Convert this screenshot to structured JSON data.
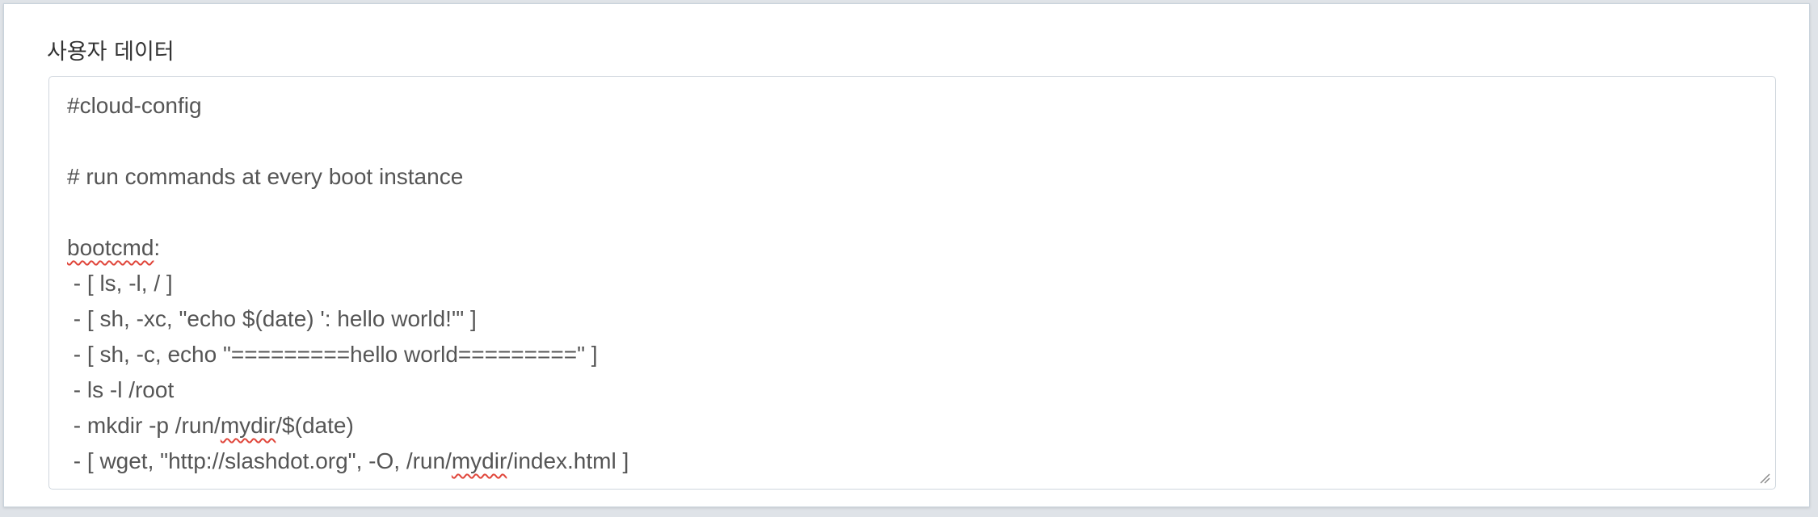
{
  "user_data": {
    "label": "사용자 데이터",
    "lines": [
      {
        "segments": [
          "#cloud-config"
        ]
      },
      {
        "segments": [
          ""
        ]
      },
      {
        "segments": [
          "# run commands at every boot instance"
        ]
      },
      {
        "segments": [
          ""
        ]
      },
      {
        "segments": [
          "bootcmd",
          ":"
        ]
      },
      {
        "segments": [
          " - [ ls, -l, / ]"
        ]
      },
      {
        "segments": [
          " - [ sh, -xc, \"echo $(date) ': hello world!'\" ]"
        ]
      },
      {
        "segments": [
          " - [ sh, -c, echo \"=========hello world=========\" ]"
        ]
      },
      {
        "segments": [
          " - ls -l /root"
        ]
      },
      {
        "segments": [
          " - mkdir -p /run/",
          "mydir",
          "/$(date)"
        ]
      },
      {
        "segments": [
          " - [ wget, \"http://slashdot.org\", -O, /run/",
          "mydir",
          "/index.html ]"
        ]
      }
    ],
    "misspelled_words": [
      "bootcmd",
      "mydir"
    ]
  }
}
